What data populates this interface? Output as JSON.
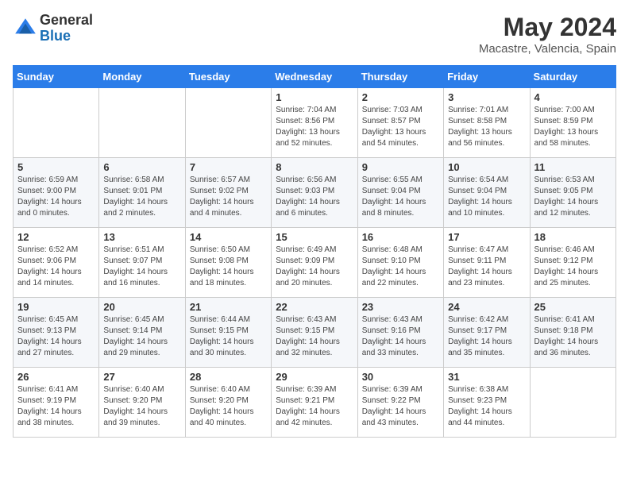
{
  "header": {
    "logo_general": "General",
    "logo_blue": "Blue",
    "month_year": "May 2024",
    "location": "Macastre, Valencia, Spain"
  },
  "days_of_week": [
    "Sunday",
    "Monday",
    "Tuesday",
    "Wednesday",
    "Thursday",
    "Friday",
    "Saturday"
  ],
  "weeks": [
    [
      {
        "day": "",
        "info": ""
      },
      {
        "day": "",
        "info": ""
      },
      {
        "day": "",
        "info": ""
      },
      {
        "day": "1",
        "info": "Sunrise: 7:04 AM\nSunset: 8:56 PM\nDaylight: 13 hours\nand 52 minutes."
      },
      {
        "day": "2",
        "info": "Sunrise: 7:03 AM\nSunset: 8:57 PM\nDaylight: 13 hours\nand 54 minutes."
      },
      {
        "day": "3",
        "info": "Sunrise: 7:01 AM\nSunset: 8:58 PM\nDaylight: 13 hours\nand 56 minutes."
      },
      {
        "day": "4",
        "info": "Sunrise: 7:00 AM\nSunset: 8:59 PM\nDaylight: 13 hours\nand 58 minutes."
      }
    ],
    [
      {
        "day": "5",
        "info": "Sunrise: 6:59 AM\nSunset: 9:00 PM\nDaylight: 14 hours\nand 0 minutes."
      },
      {
        "day": "6",
        "info": "Sunrise: 6:58 AM\nSunset: 9:01 PM\nDaylight: 14 hours\nand 2 minutes."
      },
      {
        "day": "7",
        "info": "Sunrise: 6:57 AM\nSunset: 9:02 PM\nDaylight: 14 hours\nand 4 minutes."
      },
      {
        "day": "8",
        "info": "Sunrise: 6:56 AM\nSunset: 9:03 PM\nDaylight: 14 hours\nand 6 minutes."
      },
      {
        "day": "9",
        "info": "Sunrise: 6:55 AM\nSunset: 9:04 PM\nDaylight: 14 hours\nand 8 minutes."
      },
      {
        "day": "10",
        "info": "Sunrise: 6:54 AM\nSunset: 9:04 PM\nDaylight: 14 hours\nand 10 minutes."
      },
      {
        "day": "11",
        "info": "Sunrise: 6:53 AM\nSunset: 9:05 PM\nDaylight: 14 hours\nand 12 minutes."
      }
    ],
    [
      {
        "day": "12",
        "info": "Sunrise: 6:52 AM\nSunset: 9:06 PM\nDaylight: 14 hours\nand 14 minutes."
      },
      {
        "day": "13",
        "info": "Sunrise: 6:51 AM\nSunset: 9:07 PM\nDaylight: 14 hours\nand 16 minutes."
      },
      {
        "day": "14",
        "info": "Sunrise: 6:50 AM\nSunset: 9:08 PM\nDaylight: 14 hours\nand 18 minutes."
      },
      {
        "day": "15",
        "info": "Sunrise: 6:49 AM\nSunset: 9:09 PM\nDaylight: 14 hours\nand 20 minutes."
      },
      {
        "day": "16",
        "info": "Sunrise: 6:48 AM\nSunset: 9:10 PM\nDaylight: 14 hours\nand 22 minutes."
      },
      {
        "day": "17",
        "info": "Sunrise: 6:47 AM\nSunset: 9:11 PM\nDaylight: 14 hours\nand 23 minutes."
      },
      {
        "day": "18",
        "info": "Sunrise: 6:46 AM\nSunset: 9:12 PM\nDaylight: 14 hours\nand 25 minutes."
      }
    ],
    [
      {
        "day": "19",
        "info": "Sunrise: 6:45 AM\nSunset: 9:13 PM\nDaylight: 14 hours\nand 27 minutes."
      },
      {
        "day": "20",
        "info": "Sunrise: 6:45 AM\nSunset: 9:14 PM\nDaylight: 14 hours\nand 29 minutes."
      },
      {
        "day": "21",
        "info": "Sunrise: 6:44 AM\nSunset: 9:15 PM\nDaylight: 14 hours\nand 30 minutes."
      },
      {
        "day": "22",
        "info": "Sunrise: 6:43 AM\nSunset: 9:15 PM\nDaylight: 14 hours\nand 32 minutes."
      },
      {
        "day": "23",
        "info": "Sunrise: 6:43 AM\nSunset: 9:16 PM\nDaylight: 14 hours\nand 33 minutes."
      },
      {
        "day": "24",
        "info": "Sunrise: 6:42 AM\nSunset: 9:17 PM\nDaylight: 14 hours\nand 35 minutes."
      },
      {
        "day": "25",
        "info": "Sunrise: 6:41 AM\nSunset: 9:18 PM\nDaylight: 14 hours\nand 36 minutes."
      }
    ],
    [
      {
        "day": "26",
        "info": "Sunrise: 6:41 AM\nSunset: 9:19 PM\nDaylight: 14 hours\nand 38 minutes."
      },
      {
        "day": "27",
        "info": "Sunrise: 6:40 AM\nSunset: 9:20 PM\nDaylight: 14 hours\nand 39 minutes."
      },
      {
        "day": "28",
        "info": "Sunrise: 6:40 AM\nSunset: 9:20 PM\nDaylight: 14 hours\nand 40 minutes."
      },
      {
        "day": "29",
        "info": "Sunrise: 6:39 AM\nSunset: 9:21 PM\nDaylight: 14 hours\nand 42 minutes."
      },
      {
        "day": "30",
        "info": "Sunrise: 6:39 AM\nSunset: 9:22 PM\nDaylight: 14 hours\nand 43 minutes."
      },
      {
        "day": "31",
        "info": "Sunrise: 6:38 AM\nSunset: 9:23 PM\nDaylight: 14 hours\nand 44 minutes."
      },
      {
        "day": "",
        "info": ""
      }
    ]
  ]
}
